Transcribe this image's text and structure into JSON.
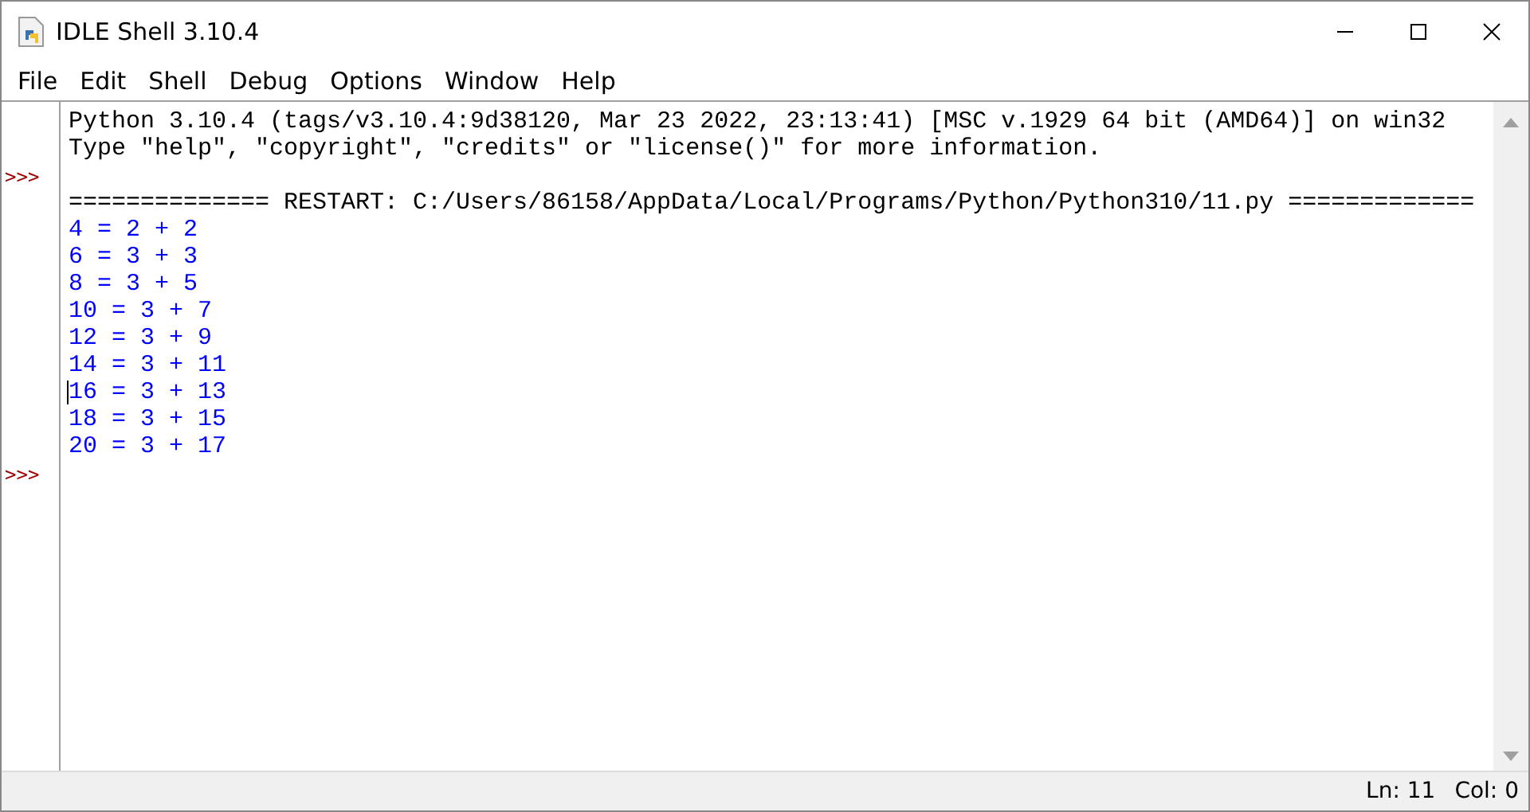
{
  "window": {
    "title": "IDLE Shell 3.10.4"
  },
  "menu": [
    {
      "label": "File"
    },
    {
      "label": "Edit"
    },
    {
      "label": "Shell"
    },
    {
      "label": "Debug"
    },
    {
      "label": "Options"
    },
    {
      "label": "Window"
    },
    {
      "label": "Help"
    }
  ],
  "shell": {
    "lines": [
      {
        "kind": "banner",
        "text": "Python 3.10.4 (tags/v3.10.4:9d38120, Mar 23 2022, 23:13:41) [MSC v.1929 64 bit (AMD64)] on win32",
        "cursor": false
      },
      {
        "kind": "banner",
        "text": "Type \"help\", \"copyright\", \"credits\" or \"license()\" for more information.",
        "cursor": false
      },
      {
        "kind": "input",
        "prompt": ">>>",
        "cursor": false
      },
      {
        "kind": "restart",
        "text": "============== RESTART: C:/Users/86158/AppData/Local/Programs/Python/Python310/11.py =============",
        "cursor": false
      },
      {
        "kind": "stdout",
        "text": "4 = 2 + 2",
        "cursor": false
      },
      {
        "kind": "stdout",
        "text": "6 = 3 + 3",
        "cursor": false
      },
      {
        "kind": "stdout",
        "text": "8 = 3 + 5",
        "cursor": false
      },
      {
        "kind": "stdout",
        "text": "10 = 3 + 7",
        "cursor": false
      },
      {
        "kind": "stdout",
        "text": "12 = 3 + 9",
        "cursor": false
      },
      {
        "kind": "stdout",
        "text": "14 = 3 + 11",
        "cursor": false
      },
      {
        "kind": "stdout",
        "text": "16 = 3 + 13",
        "cursor": true
      },
      {
        "kind": "stdout",
        "text": "18 = 3 + 15",
        "cursor": false
      },
      {
        "kind": "stdout",
        "text": "20 = 3 + 17",
        "cursor": false
      },
      {
        "kind": "input",
        "prompt": ">>>",
        "cursor": false
      }
    ]
  },
  "status_bar": {
    "line": "Ln: 11",
    "column": "Col: 0"
  }
}
